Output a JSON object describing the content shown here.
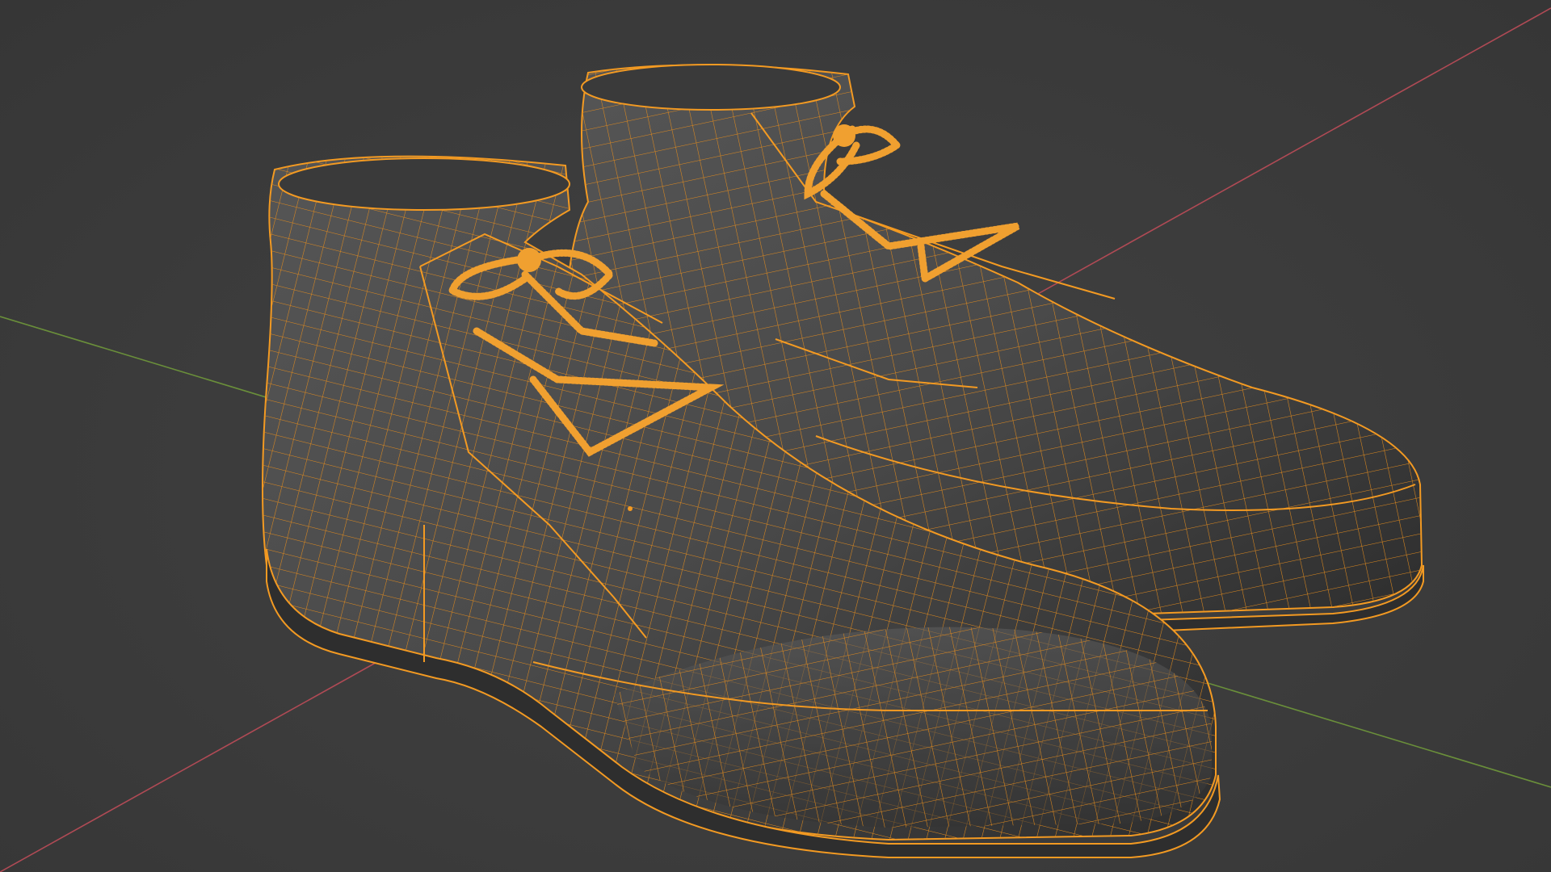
{
  "viewport": {
    "background": "#3d3d3d",
    "axis_x_color": "#b04a55",
    "axis_y_color": "#6a8f3a",
    "wireframe_color": "#f39a22",
    "mesh_fill": "#4a4a4a"
  },
  "objects": [
    {
      "name": "shoe-left",
      "selected": true
    },
    {
      "name": "shoe-right",
      "selected": true
    }
  ],
  "origin_marker": "3d-cursor-icon"
}
